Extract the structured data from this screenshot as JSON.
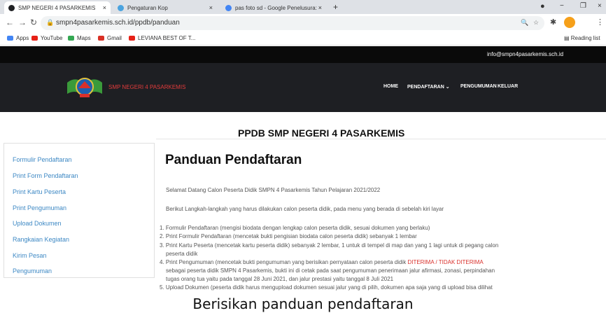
{
  "browser": {
    "tabs": [
      {
        "title": "SMP NEGERI 4 PASARKEMIS",
        "close": "×",
        "icon_color": "#202124"
      },
      {
        "title": "Pengaturan Kop",
        "close": "×",
        "icon_color": "#4aa3df"
      },
      {
        "title": "pas foto sd - Google Penelusura:",
        "close": "×",
        "icon_color": "#4285f4"
      }
    ],
    "new_tab": "+",
    "window_controls": {
      "minimize": "−",
      "maximize": "❐",
      "close": "×"
    },
    "url": "smpn4pasarkemis.sch.id/ppdb/panduan",
    "bookmarks": [
      {
        "label": "Apps",
        "color": "#4285f4"
      },
      {
        "label": "YouTube",
        "color": "#e62117"
      },
      {
        "label": "Maps",
        "color": "#34a853"
      },
      {
        "label": "Gmail",
        "color": "#d93025"
      },
      {
        "label": "LEVIANA BEST OF T...",
        "color": "#e62117"
      }
    ],
    "reading_list": "Reading list",
    "icons": {
      "back": "arrow-left-icon",
      "forward": "arrow-right-icon",
      "reload": "reload-icon",
      "lock": "lock-icon"
    }
  },
  "site": {
    "email": "info@smpn4pasarkemis.sch.id",
    "name": "SMP NEGERI 4 PASARKEMIS",
    "menu": {
      "home": "HOME",
      "pendaftaran": "PENDAFTARAN ⌄",
      "pengumuman": "PENGUMUMAN",
      "keluar": "KELUAR"
    },
    "colors": {
      "topbar": "#0a0a0a",
      "header": "#1e1f23",
      "accent": "#e23b3b",
      "link": "#3d88c4"
    }
  },
  "page": {
    "ppdb_title": "PPDB SMP NEGERI 4 PASARKEMIS",
    "sidebar": [
      "Formulir Pendaftaran",
      "Print Form Pendaftaran",
      "Print Kartu Peserta",
      "Print Pengumuman",
      "Upload Dokumen",
      "Rangkaian Kegiatan",
      "Kirim Pesan",
      "Pengumuman"
    ],
    "title": "Panduan Pendaftaran",
    "welcome": "Selamat Datang Calon Peserta Didik SMPN 4 Pasarkemis Tahun Pelajaran 2021/2022",
    "intro": "Berikut Langkah-langkah yang harus dilakukan calon peserta didik, pada menu yang berada di sebelah kiri layar",
    "steps": {
      "s1": "1. Formulir Pendaftaran (mengisi biodata dengan lengkap calon peserta didik, sesuai dokumen yang berlaku)",
      "s2": "2. Print Formulir Pendaftaran (mencetak bukti pengisian biodata calon peserta didik) sebanyak 1 lembar",
      "s3a": "3. Print Kartu Peserta (mencetak kartu peserta didik) sebanyak 2 lembar, 1 untuk di tempel di map dan yang 1 lagi untuk di pegang calon",
      "s3b": "peserta didik",
      "s4a": "4. Print Pengumuman (mencetak bukti pengumuman yang berisikan pernyataan calon peserta didik ",
      "s4a_red": "DITERIMA / TIDAK DITERIMA",
      "s4b": "sebagai peserta didik SMPN 4 Pasarkemis, bukti ini di cetak pada saat pengumuman penerimaan jalur afirmasi, zonasi, perpindahan",
      "s4c": "tugas orang tua yaitu pada tanggal 28 Juni 2021, dan jalur prestasi yaitu tanggal 8 Juli 2021",
      "s5": "5. Upload Dokumen (peserta didik harus mengupload dokumen sesuai jalur yang di pilih, dokumen apa saja yang di upload bisa dilihat"
    }
  },
  "caption": "Berisikan panduan pendaftaran"
}
